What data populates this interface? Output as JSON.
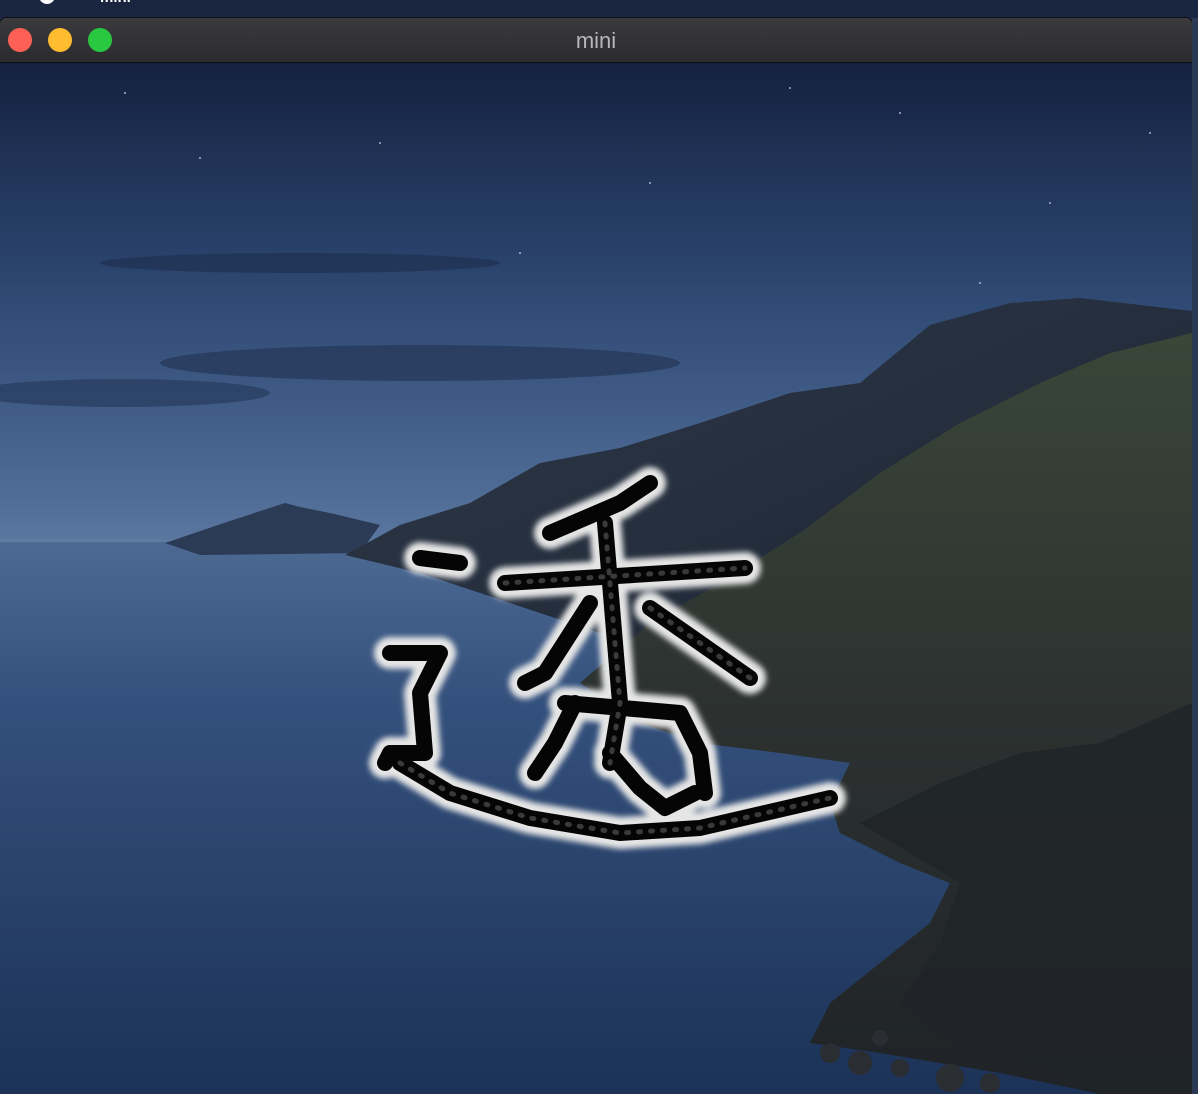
{
  "menubar": {
    "app_name": "mini"
  },
  "window": {
    "title": "mini"
  },
  "canvas": {
    "glyph_text": "透"
  },
  "colors": {
    "close": "#fe5f57",
    "minimize": "#febc2e",
    "zoom": "#28c840",
    "titlebar": "#2c2c2e"
  },
  "icons": [
    "apple-icon",
    "close-icon",
    "minimize-icon",
    "zoom-icon"
  ]
}
